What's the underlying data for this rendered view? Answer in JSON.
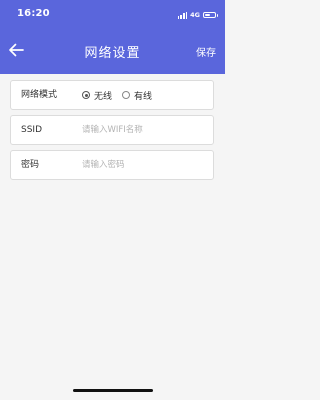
{
  "status_bar": {
    "time": "16:20",
    "network": "4G",
    "battery_level": 0.6
  },
  "nav": {
    "title": "网络设置",
    "save_label": "保存",
    "back_icon": "arrow-left-icon"
  },
  "form": {
    "network_mode": {
      "label": "网络模式",
      "options": [
        {
          "label": "无线",
          "selected": true
        },
        {
          "label": "有线",
          "selected": false
        }
      ]
    },
    "ssid": {
      "label": "SSID",
      "value": "",
      "placeholder": "请输入WIFI名称"
    },
    "password": {
      "label": "密码",
      "value": "",
      "placeholder": "请输入密码"
    }
  },
  "colors": {
    "header_bg": "#5a66dc",
    "page_bg": "#f5f5f5",
    "card_border": "#dcdcdc"
  }
}
